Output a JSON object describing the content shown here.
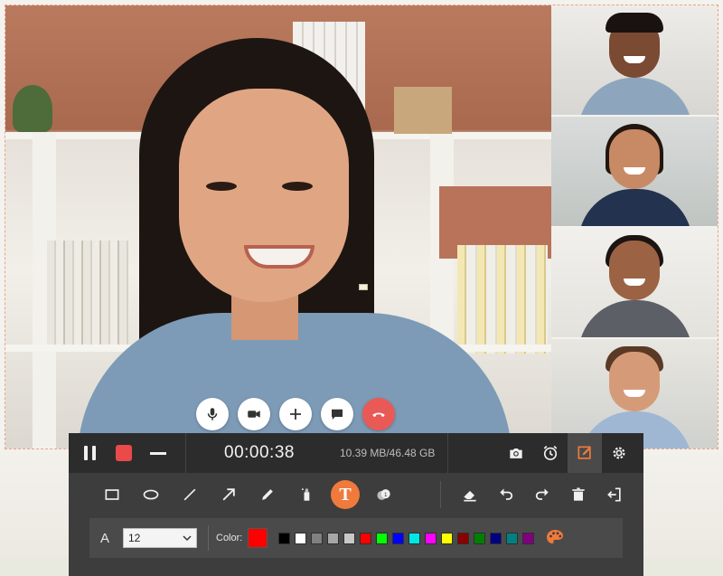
{
  "recorder": {
    "timer": "00:00:38",
    "storage": "10.39 MB/46.48 GB",
    "font_label": "A",
    "font_size": "12",
    "color_label": "Color:",
    "current_color": "#ff0000",
    "palette": [
      "#000000",
      "#ffffff",
      "#808080",
      "#a6a6a6",
      "#c8c8c8",
      "#ff0000",
      "#00ff00",
      "#0000ff",
      "#00e5e5",
      "#ff00ff",
      "#ffff00",
      "#8b0000",
      "#008000",
      "#000080",
      "#008080",
      "#800080"
    ],
    "accent_color": "#f07a3c",
    "text_tool_glyph": "T"
  },
  "call": {
    "end_color": "#e95a56"
  }
}
